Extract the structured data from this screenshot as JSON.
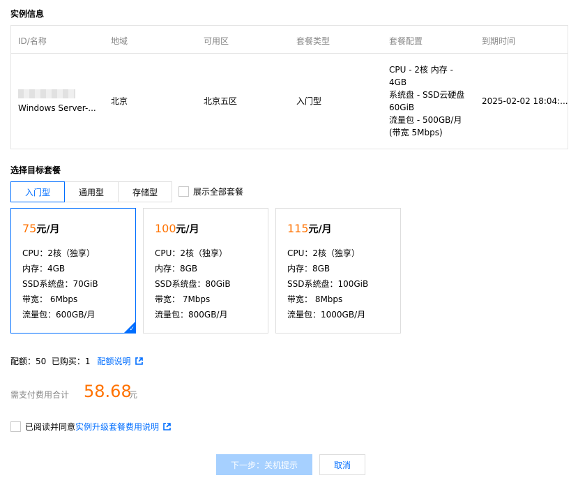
{
  "instance_section": {
    "title": "实例信息"
  },
  "instance_table": {
    "headers": [
      "ID/名称",
      "地域",
      "可用区",
      "套餐类型",
      "套餐配置",
      "到期时间"
    ],
    "row": {
      "name": "Windows Server-...",
      "region": "北京",
      "zone": "北京五区",
      "package_type": "入门型",
      "config_lines": [
        "CPU - 2核 内存 -",
        "4GB",
        "系统盘 - SSD云硬盘",
        "60GiB",
        "流量包 - 500GB/月",
        "(带宽 5Mbps)"
      ],
      "expire": "2025-02-02 18:04:..."
    }
  },
  "target_section": {
    "title": "选择目标套餐"
  },
  "tabs": [
    {
      "label": "入门型",
      "active": true
    },
    {
      "label": "通用型",
      "active": false
    },
    {
      "label": "存储型",
      "active": false
    }
  ],
  "show_all_label": "展示全部套餐",
  "plans": [
    {
      "price": "75",
      "unit": "元/月",
      "cpu": "CPU：2核（独享）",
      "mem": "内存：4GB",
      "ssd": "SSD系统盘：70GiB",
      "bw": "带宽：  6Mbps",
      "traffic": "流量包：600GB/月",
      "selected": true
    },
    {
      "price": "100",
      "unit": "元/月",
      "cpu": "CPU：2核（独享）",
      "mem": "内存：8GB",
      "ssd": "SSD系统盘：80GiB",
      "bw": "带宽：  7Mbps",
      "traffic": "流量包：800GB/月",
      "selected": false
    },
    {
      "price": "115",
      "unit": "元/月",
      "cpu": "CPU：2核（独享）",
      "mem": "内存：8GB",
      "ssd": "SSD系统盘：100GiB",
      "bw": "带宽：  8Mbps",
      "traffic": "流量包：1000GB/月",
      "selected": false
    }
  ],
  "quota": {
    "text": "配额：50  已购买：1",
    "link": "配额说明"
  },
  "total": {
    "label": "需支付费用合计",
    "amount": "58.68",
    "unit": "元"
  },
  "agreement": {
    "text": "已阅读并同意",
    "link": "实例升级套餐费用说明"
  },
  "buttons": {
    "next": "下一步：关机提示",
    "cancel": "取消"
  },
  "colors": {
    "accent": "#006eff",
    "price": "#ff7200",
    "disabled_primary": "#a6d0ff"
  },
  "icons": {
    "external_link": "external-link-icon",
    "selected_corner": "check-icon"
  }
}
